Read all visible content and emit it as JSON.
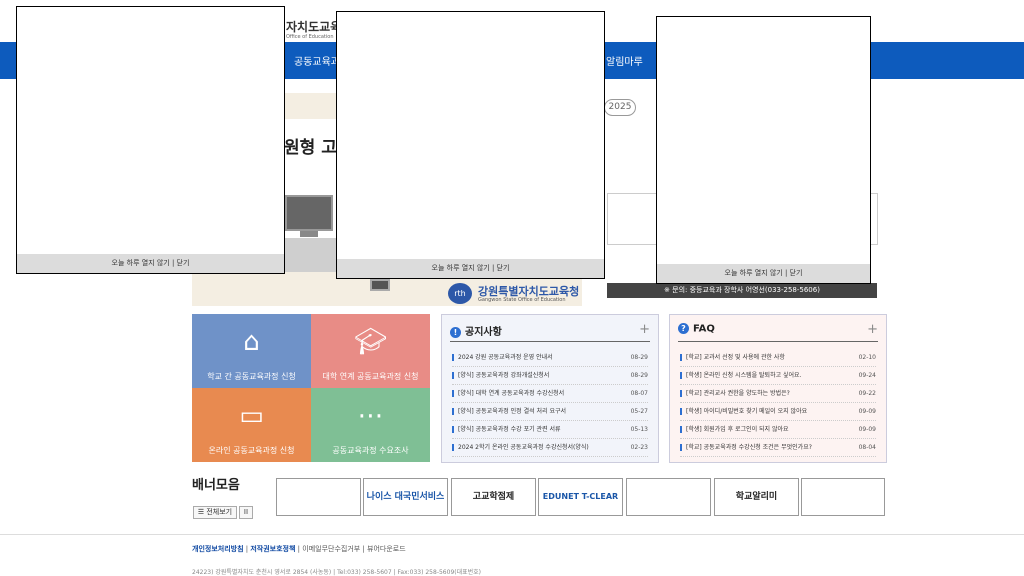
{
  "header": {
    "logo_text": "자치도교육청",
    "logo_sub": "Office of Education"
  },
  "nav": {
    "item_1": "공동교육과",
    "item_2": "알림마루"
  },
  "hero": {
    "title": "원형 고",
    "year": "2025",
    "edu_logo": "강원특별자치도교육청",
    "edu_logo_sub": "Gangwon State Office of Education",
    "edu_logo_mark": "rth",
    "contact": "※ 문의: 중등교육과 장학사 어영선(033-258-5606)"
  },
  "tiles": [
    {
      "label": "학교 간 공동교육과정 신청",
      "icon": "school-icon"
    },
    {
      "label": "대학 연계 공동교육과정 신청",
      "icon": "graduation-cap-icon"
    },
    {
      "label": "온라인 공동교육과정 신청",
      "icon": "laptop-icon"
    },
    {
      "label": "공동교육과정 수요조사",
      "icon": "chat-bubble-icon"
    }
  ],
  "notice": {
    "title": "공지사항",
    "items": [
      {
        "title": "2024 강원 공동교육과정 운영 안내서",
        "date": "08-29"
      },
      {
        "title": "[양식] 공동교육과정 강좌개설신청서",
        "date": "08-29"
      },
      {
        "title": "[양식] 대학 연계 공동교육과정 수강신청서",
        "date": "08-07"
      },
      {
        "title": "[양식] 공동교육과정 인정 결석 처리 요구서",
        "date": "05-27"
      },
      {
        "title": "[양식] 공동교육과정 수강 포기 관련 서류",
        "date": "05-13"
      },
      {
        "title": "2024 2학기 온라인 공동교육과정 수강신청서(양식)",
        "date": "02-23"
      }
    ]
  },
  "faq": {
    "title": "FAQ",
    "items": [
      {
        "title": "[학교] 교과서 선정 및 사용에 관한 사항",
        "date": "02-10"
      },
      {
        "title": "[학생] 온라인 신청 시스템을 탈퇴하고 싶어요.",
        "date": "09-24"
      },
      {
        "title": "[학교] 관리교사 권한을 양도하는 방법은?",
        "date": "09-22"
      },
      {
        "title": "[학생] 아이디/비밀번호 찾기 메일이 오지 않아요",
        "date": "09-09"
      },
      {
        "title": "[학생] 회원가입 후 로그인이 되지 않아요",
        "date": "09-09"
      },
      {
        "title": "[학교] 공동교육과정 수강신청 조건은 무엇인가요?",
        "date": "08-04"
      }
    ]
  },
  "banners": {
    "title": "배너모음",
    "view_all": "☰ 전체보기",
    "pause": "II",
    "items": [
      "",
      "나이스 대국민서비스",
      "고교학점제",
      "EDUNET T-CLEAR",
      "",
      "학교알리미",
      ""
    ]
  },
  "footer": {
    "privacy": "개인정보처리방침",
    "copyright": "저작권보호정책",
    "email": "이메일무단수집거부",
    "viewer": "뷰어다운로드",
    "address": "24223) 강원특별자치도 춘천시 영서로 2854 (사농동) | Tel:033) 258-5607 | Fax:033) 258-5609(대표번호)"
  },
  "popups": {
    "close_label": "오늘 하루 열지 않기 | 닫기"
  }
}
